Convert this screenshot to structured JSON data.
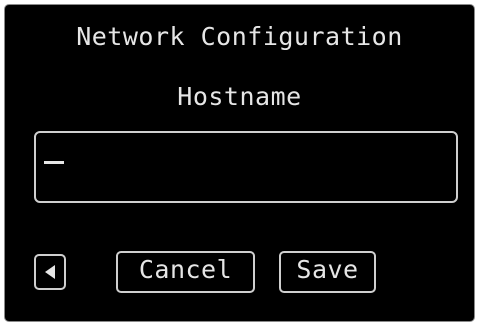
{
  "screen": {
    "title": "Network Configuration",
    "field_label": "Hostname",
    "hostname_value": ""
  },
  "buttons": {
    "back_icon": "left-arrow-icon",
    "cancel_label": "Cancel",
    "save_label": "Save"
  },
  "colors": {
    "background": "#000000",
    "foreground": "#e6e6e6",
    "border": "#cfcfcf"
  }
}
